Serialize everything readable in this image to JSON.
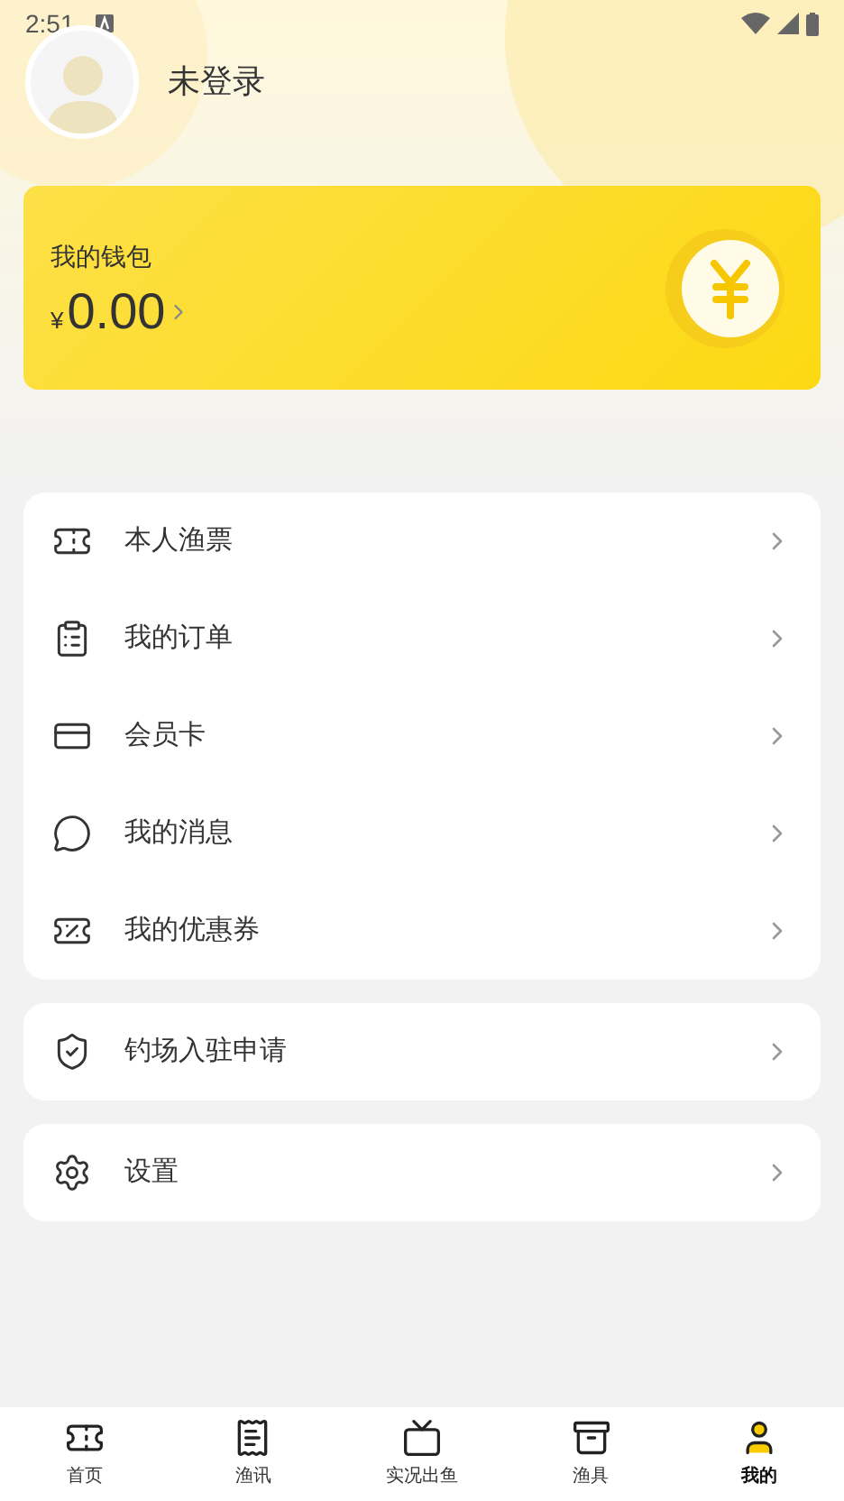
{
  "status_bar": {
    "time": "2:51"
  },
  "profile": {
    "name": "未登录"
  },
  "wallet": {
    "title": "我的钱包",
    "currency": "¥",
    "amount": "0.00"
  },
  "menu_groups": [
    {
      "items": [
        {
          "label": "本人渔票",
          "kind": "ticket"
        },
        {
          "label": "我的订单",
          "kind": "order"
        },
        {
          "label": "会员卡",
          "kind": "card"
        },
        {
          "label": "我的消息",
          "kind": "message"
        },
        {
          "label": "我的优惠券",
          "kind": "coupon"
        }
      ]
    },
    {
      "items": [
        {
          "label": "钓场入驻申请",
          "kind": "shield"
        }
      ]
    },
    {
      "items": [
        {
          "label": "设置",
          "kind": "settings"
        }
      ]
    }
  ],
  "bottom_nav": [
    {
      "label": "首页",
      "kind": "home",
      "selected": false
    },
    {
      "label": "渔讯",
      "kind": "news",
      "selected": false
    },
    {
      "label": "实况出鱼",
      "kind": "live",
      "selected": false
    },
    {
      "label": "渔具",
      "kind": "gear",
      "selected": false
    },
    {
      "label": "我的",
      "kind": "me",
      "selected": true
    }
  ]
}
